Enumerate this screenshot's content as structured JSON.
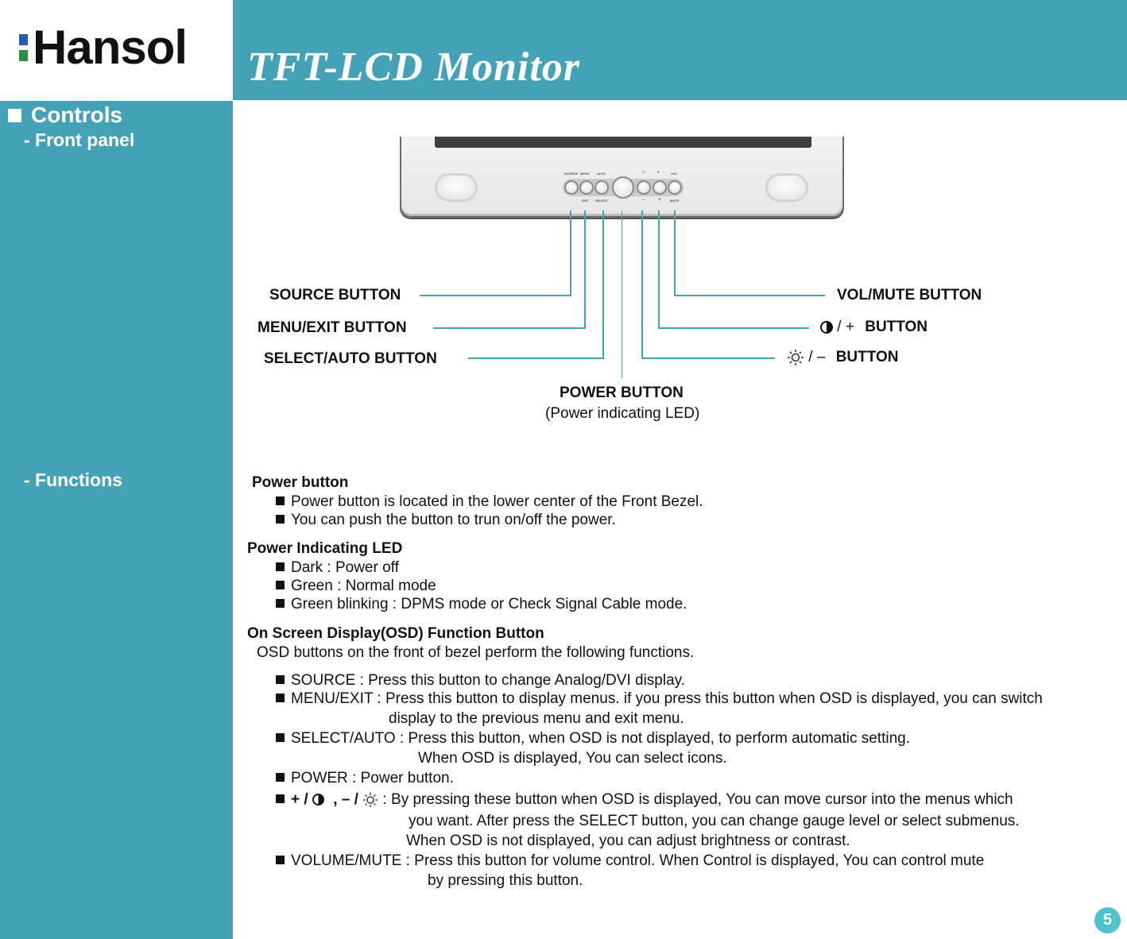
{
  "header": {
    "logo_text": "Hansol",
    "logo_colors": {
      "top_mark": "#2a5db0",
      "bottom_mark": "#2e8b4a"
    },
    "title": "TFT-LCD Monitor",
    "brand_color": "#44a2b6"
  },
  "sidebar": {
    "heading": "Controls",
    "sub_front_panel": "- Front panel",
    "sub_functions": "- Functions"
  },
  "diagram": {
    "bezel_labels": {
      "top": [
        "SOURCE",
        "MENU",
        "AUTO",
        "☼",
        "◑",
        "VOL"
      ],
      "bottom": [
        "EXIT",
        "SELECT",
        "–",
        "+",
        "MUTE"
      ]
    },
    "labels": {
      "source": "SOURCE BUTTON",
      "menu_exit": "MENU/EXIT BUTTON",
      "select_auto": "SELECT/AUTO BUTTON",
      "vol_mute": "VOL/MUTE BUTTON",
      "contrast_plus_sep": "/ +",
      "contrast_plus": "BUTTON",
      "bright_minus_sep": "/ –",
      "bright_minus": "BUTTON",
      "power": "POWER BUTTON",
      "power_sub": "(Power indicating LED)"
    },
    "leader_color": "#3aa6ad"
  },
  "functions": {
    "power_button": {
      "title": "Power button",
      "items": [
        "Power button is located in the lower center of the Front Bezel.",
        "You can push the button to trun on/off the power."
      ]
    },
    "power_led": {
      "title": "Power Indicating LED",
      "items": [
        "Dark : Power off",
        "Green : Normal mode",
        "Green blinking : DPMS mode or Check Signal Cable mode."
      ]
    },
    "osd": {
      "title": "On Screen Display(OSD) Function Button",
      "intro": "OSD buttons on the front of bezel perform the following functions.",
      "source": "SOURCE : Press this button to change Analog/DVI display.",
      "menu_exit_1": "MENU/EXIT : Press this button to display menus. if you press this button when OSD is displayed, you can switch",
      "menu_exit_2": "display to the previous menu and exit menu.",
      "select_auto_1": "SELECT/AUTO : Press this button, when OSD is not displayed, to perform automatic setting.",
      "select_auto_2": "When OSD is displayed, You can select icons.",
      "power": "POWER : Power button.",
      "plus_sym": "+ /",
      "comma_minus_sym": ", – /",
      "adjust_1": ": By pressing these button when OSD is displayed, You can move cursor into the menus which",
      "adjust_2": "you want. After press the SELECT button, you can change gauge level or select submenus.",
      "adjust_3": "When OSD is not displayed, you can adjust brightness or contrast.",
      "volume_1": "VOLUME/MUTE : Press this button for volume control. When Control is displayed, You can control mute",
      "volume_2": "by pressing this button."
    }
  },
  "page_number": "5"
}
